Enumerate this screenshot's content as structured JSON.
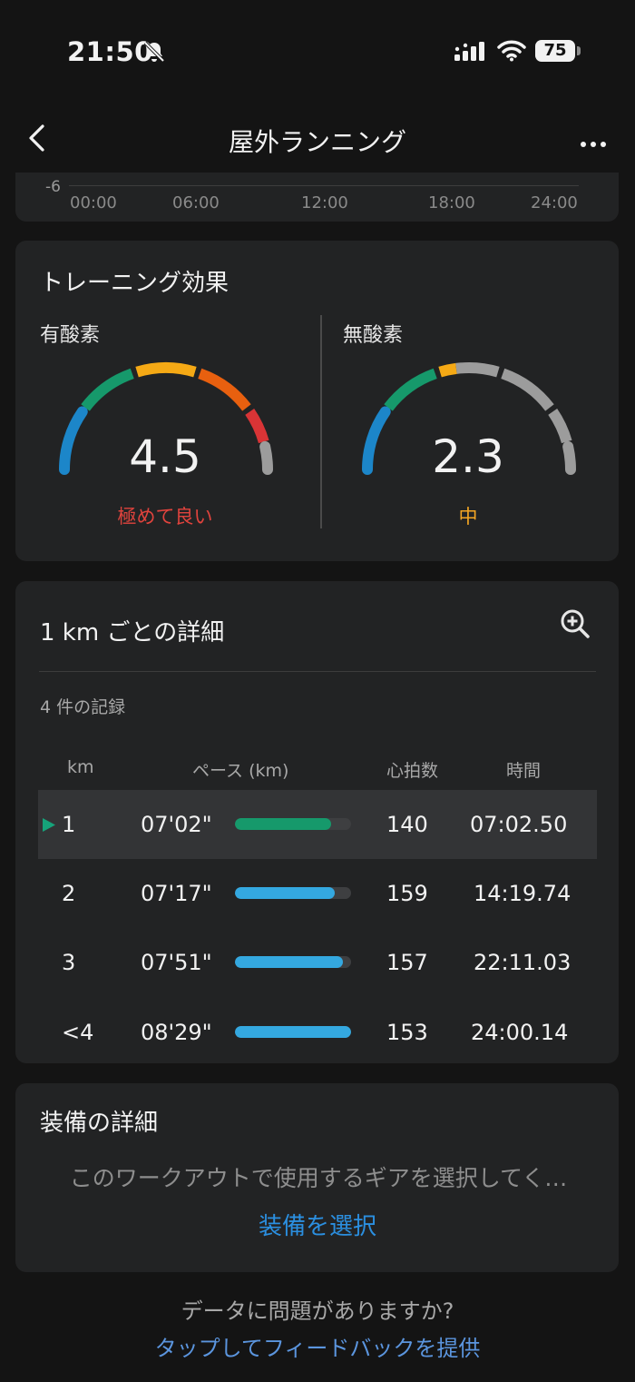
{
  "status_bar": {
    "time": "21:50",
    "battery": "75"
  },
  "nav": {
    "title": "屋外ランニング"
  },
  "chart_axis": {
    "y_min_label": "-6",
    "x_ticks": [
      "00:00",
      "06:00",
      "12:00",
      "18:00",
      "24:00"
    ]
  },
  "training_effect": {
    "title": "トレーニング効果",
    "aerobic": {
      "label": "有酸素",
      "value": "4.5",
      "status": "極めて良い",
      "status_color": "#e0433d"
    },
    "anaerobic": {
      "label": "無酸素",
      "value": "2.3",
      "status": "中",
      "status_color": "#f5a623"
    },
    "segment_colors": [
      "#1c86c9",
      "#16996b",
      "#f5a915",
      "#e8600f",
      "#d93436",
      "#9c9c9c"
    ]
  },
  "km_details": {
    "title": "1 km ごとの詳細",
    "records": "4 件の記録",
    "headers": {
      "km": "km",
      "pace": "ペース (km)",
      "hr": "心拍数",
      "time": "時間"
    },
    "rows": [
      {
        "km": "1",
        "pace": "07'02\"",
        "pace_fraction": 0.83,
        "bar_color": "#16996b",
        "hr": "140",
        "time": "07:02.50",
        "active": true
      },
      {
        "km": "2",
        "pace": "07'17\"",
        "pace_fraction": 0.86,
        "bar_color": "#34a8e0",
        "hr": "159",
        "time": "14:19.74",
        "active": false
      },
      {
        "km": "3",
        "pace": "07'51\"",
        "pace_fraction": 0.93,
        "bar_color": "#34a8e0",
        "hr": "157",
        "time": "22:11.03",
        "active": false
      },
      {
        "km": "<4",
        "pace": "08'29\"",
        "pace_fraction": 1.0,
        "bar_color": "#34a8e0",
        "hr": "153",
        "time": "24:00.14",
        "active": false
      }
    ]
  },
  "equipment": {
    "title": "装備の詳細",
    "message": "このワークアウトで使用するギアを選択してく…",
    "link": "装備を選択"
  },
  "feedback": {
    "question": "データに問題がありますか?",
    "link": "タップしてフィードバックを提供"
  }
}
